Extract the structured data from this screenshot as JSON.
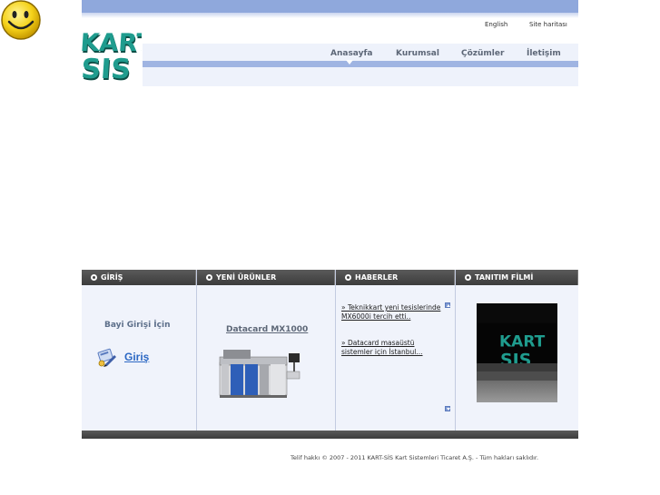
{
  "header": {
    "top_links": {
      "english": "English",
      "sitemap": "Site haritası"
    },
    "logo_text": [
      "KART",
      "SIS"
    ]
  },
  "nav": {
    "items": [
      {
        "label": "Anasayfa"
      },
      {
        "label": "Kurumsal"
      },
      {
        "label": "Çözümler"
      },
      {
        "label": "İletişim"
      }
    ],
    "active": "Anasayfa"
  },
  "panels": {
    "login": {
      "title": "GİRİŞ",
      "dealer_label": "Bayi Girişi İçin",
      "button_label": "Giriş"
    },
    "new_products": {
      "title": "YENİ ÜRÜNLER",
      "product_name": "Datacard MX1000"
    },
    "news": {
      "title": "HABERLER",
      "items": [
        "» Teknikkart yeni tesislerinde MX6000i tercih etti..",
        "» Datacard masaüstü sistemler için İstanbul..."
      ]
    },
    "video": {
      "title": "TANITIM FİLMİ",
      "video_text": [
        "KART",
        "SIS"
      ]
    }
  },
  "footer": {
    "copyright": "Telif hakkı © 2007 - 2011 KART-SİS Kart Sistemleri Ticaret A.Ş. - Tüm hakları saklıdır."
  },
  "colors": {
    "header_blue": "#8fa8dc",
    "nav_bar": "#9fb4e2",
    "panel_bg": "#f0f3fb",
    "panel_header": "#4a4a4a",
    "logo_teal": "#1f9c8e",
    "link_blue": "#2c68c4"
  }
}
